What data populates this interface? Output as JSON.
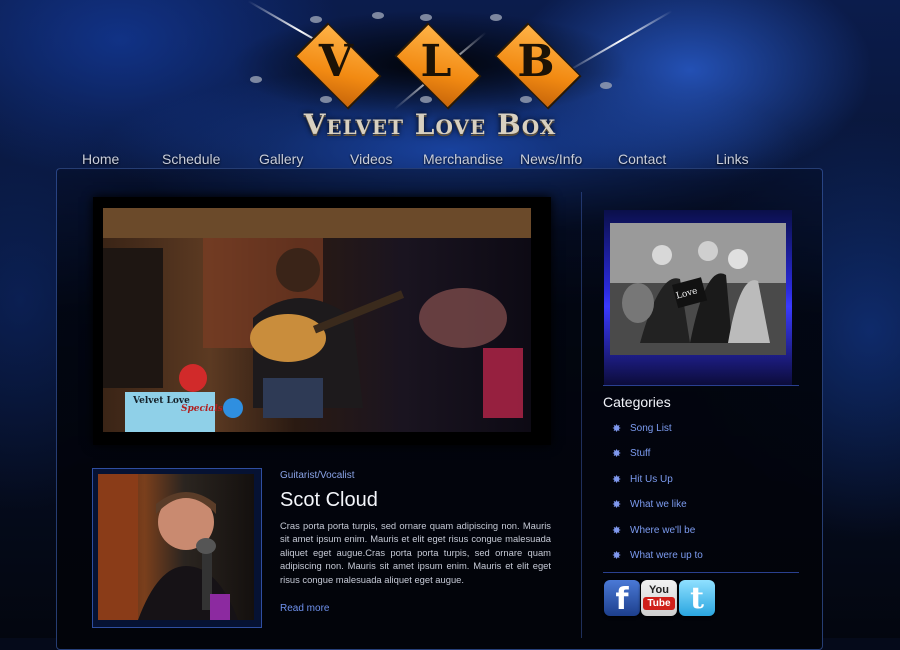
{
  "logo": {
    "letters": [
      "V",
      "L",
      "B"
    ],
    "band_name": "Velvet Love Box",
    "accent_color": "#f28a12"
  },
  "nav": {
    "items": [
      "Home",
      "Schedule",
      "Gallery",
      "Videos",
      "Merchandise",
      "News/Info",
      "Contact",
      "Links"
    ]
  },
  "hero": {
    "sign_text": "Velvet Love",
    "sign_subtext": "Specials"
  },
  "profile": {
    "role": "Guitarist/Vocalist",
    "name": "Scot Cloud",
    "bio": "Cras porta porta turpis, sed ornare quam adipiscing non. Mauris sit amet ipsum enim. Mauris et elit eget risus congue malesuada aliquet eget augue.Cras porta porta turpis, sed ornare quam adipiscing non. Mauris sit amet ipsum enim. Mauris et elit eget risus congue malesuada aliquet eget augue.",
    "read_more": "Read more"
  },
  "sidebar": {
    "photo_label": "Love",
    "categories_title": "Categories",
    "categories": [
      "Song List",
      "Stuff",
      "Hit Us Up",
      "What we like",
      "Where we'll be",
      "What were up to"
    ],
    "social": [
      {
        "name": "facebook-icon",
        "glyph": "f"
      },
      {
        "name": "youtube-icon",
        "glyph_top": "You",
        "glyph_bottom": "Tube"
      },
      {
        "name": "twitter-icon",
        "glyph": "t"
      }
    ]
  }
}
